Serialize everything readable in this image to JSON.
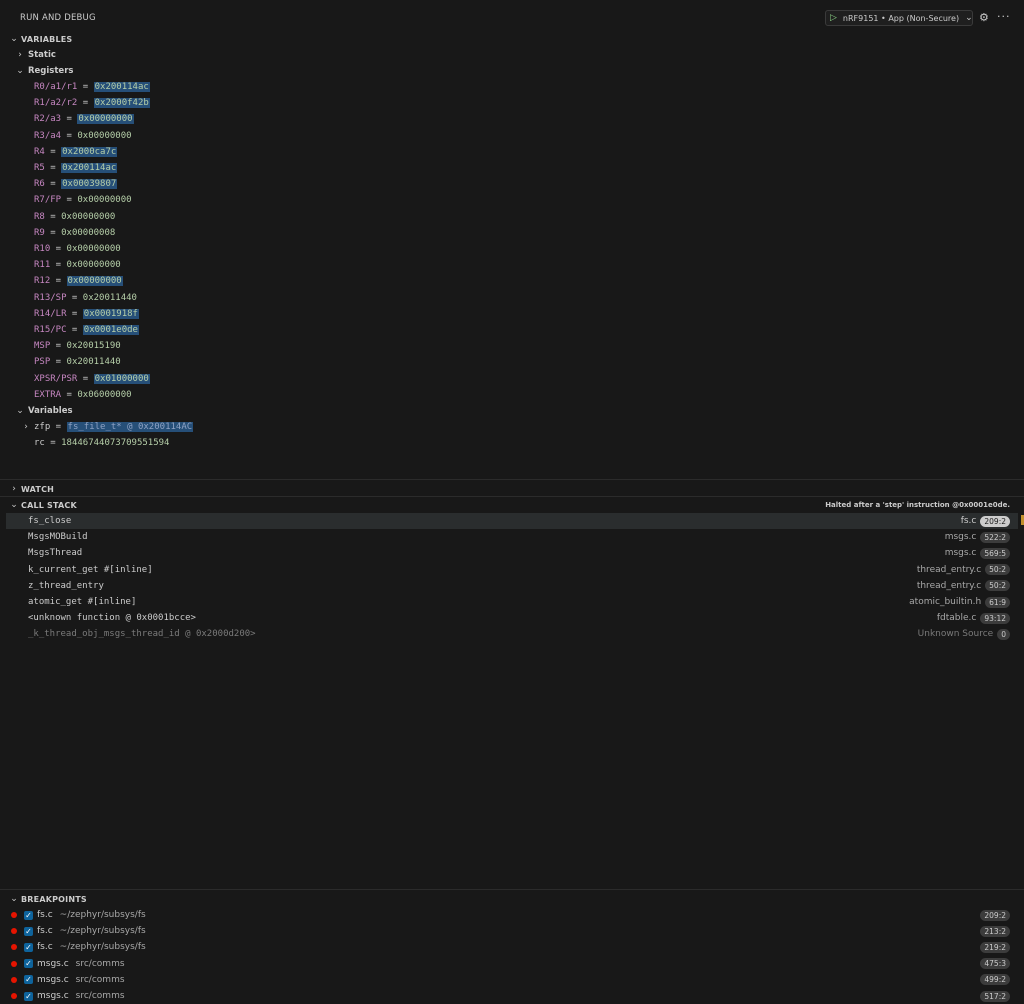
{
  "header": {
    "title": "RUN AND DEBUG",
    "launch_config": "nRF9151 • App (Non-Secure)",
    "icons": {
      "play": "play-icon",
      "chevron": "chevron-down-icon",
      "gear": "gear-icon",
      "more": "more-actions-icon"
    }
  },
  "variables": {
    "section_label": "VARIABLES",
    "static_label": "Static",
    "registers_label": "Registers",
    "registers": [
      {
        "name": "R0/a1/r1",
        "value": "0x200114ac",
        "changed": true
      },
      {
        "name": "R1/a2/r2",
        "value": "0x2000f42b",
        "changed": true
      },
      {
        "name": "R2/a3",
        "value": "0x00000000",
        "changed": true
      },
      {
        "name": "R3/a4",
        "value": "0x00000000",
        "changed": false
      },
      {
        "name": "R4",
        "value": "0x2000ca7c",
        "changed": true
      },
      {
        "name": "R5",
        "value": "0x200114ac",
        "changed": true
      },
      {
        "name": "R6",
        "value": "0x00039807",
        "changed": true
      },
      {
        "name": "R7/FP",
        "value": "0x00000000",
        "changed": false
      },
      {
        "name": "R8",
        "value": "0x00000000",
        "changed": false
      },
      {
        "name": "R9",
        "value": "0x00000008",
        "changed": false
      },
      {
        "name": "R10",
        "value": "0x00000000",
        "changed": false
      },
      {
        "name": "R11",
        "value": "0x00000000",
        "changed": false
      },
      {
        "name": "R12",
        "value": "0x00000000",
        "changed": true
      },
      {
        "name": "R13/SP",
        "value": "0x20011440",
        "changed": false
      },
      {
        "name": "R14/LR",
        "value": "0x0001918f",
        "changed": true
      },
      {
        "name": "R15/PC",
        "value": "0x0001e0de",
        "changed": true
      },
      {
        "name": "MSP",
        "value": "0x20015190",
        "changed": false
      },
      {
        "name": "PSP",
        "value": "0x20011440",
        "changed": false
      },
      {
        "name": "XPSR/PSR",
        "value": "0x01000000",
        "changed": true
      },
      {
        "name": "EXTRA",
        "value": "0x06000000",
        "changed": false
      }
    ],
    "locals_label": "Variables",
    "locals": [
      {
        "name": "zfp",
        "value": "fs_file_t* @ 0x200114AC",
        "expandable": true
      },
      {
        "name": "rc",
        "value": "18446744073709551594",
        "expandable": false
      }
    ]
  },
  "watch": {
    "section_label": "WATCH"
  },
  "call_stack": {
    "section_label": "CALL STACK",
    "status": "Halted after a 'step' instruction @0x0001e0de.",
    "frames": [
      {
        "fn": "fs_close",
        "src": "fs.c",
        "line": "209:2"
      },
      {
        "fn": "MsgsMOBuild",
        "src": "msgs.c",
        "line": "522:2"
      },
      {
        "fn": "MsgsThread",
        "src": "msgs.c",
        "line": "569:5"
      },
      {
        "fn": "k_current_get #[inline]",
        "src": "thread_entry.c",
        "line": "50:2"
      },
      {
        "fn": "z_thread_entry",
        "src": "thread_entry.c",
        "line": "50:2"
      },
      {
        "fn": "atomic_get #[inline]",
        "src": "atomic_builtin.h",
        "line": "61:9"
      },
      {
        "fn": "<unknown function @ 0x0001bcce>",
        "src": "fdtable.c",
        "line": "93:12"
      },
      {
        "fn": "_k_thread_obj_msgs_thread_id @ 0x2000d200>",
        "src": "Unknown Source",
        "line": "0"
      }
    ]
  },
  "breakpoints": {
    "section_label": "BREAKPOINTS",
    "items": [
      {
        "file": "fs.c",
        "path": "~/zephyr/subsys/fs",
        "line": "209:2"
      },
      {
        "file": "fs.c",
        "path": "~/zephyr/subsys/fs",
        "line": "213:2"
      },
      {
        "file": "fs.c",
        "path": "~/zephyr/subsys/fs",
        "line": "219:2"
      },
      {
        "file": "msgs.c",
        "path": "src/comms",
        "line": "475:3"
      },
      {
        "file": "msgs.c",
        "path": "src/comms",
        "line": "499:2"
      },
      {
        "file": "msgs.c",
        "path": "src/comms",
        "line": "517:2"
      }
    ]
  }
}
